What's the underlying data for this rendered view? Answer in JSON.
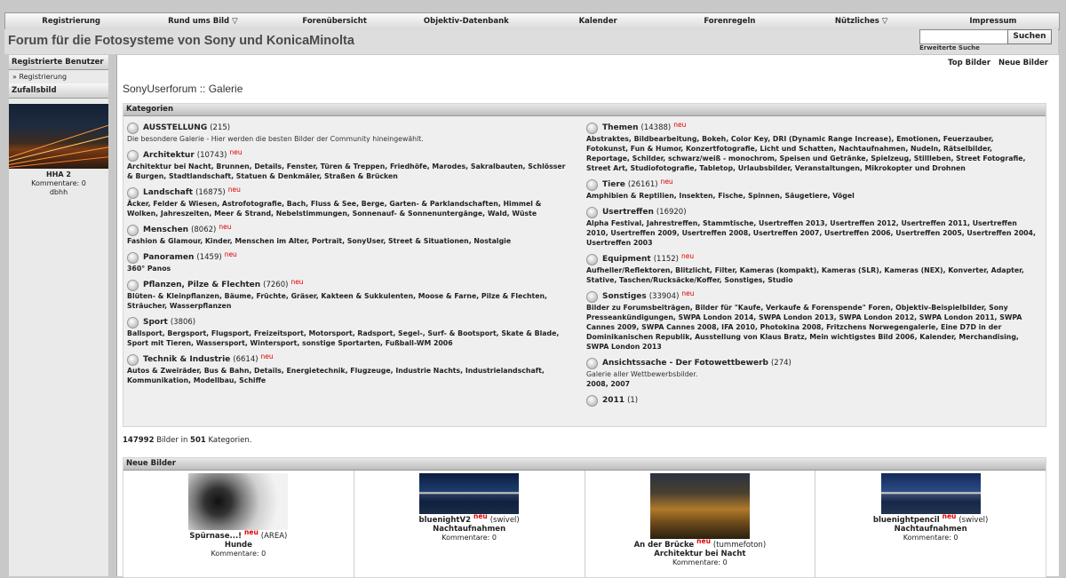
{
  "nav": [
    "Registrierung",
    "Rund ums Bild ▽",
    "Forenübersicht",
    "Objektiv-Datenbank",
    "Kalender",
    "Forenregeln",
    "Nützliches ▽",
    "Impressum"
  ],
  "site_title": "Forum für die Fotosysteme von Sony und KonicaMinolta",
  "search": {
    "button": "Suchen",
    "advanced": "Erweiterte Suche",
    "value": ""
  },
  "sidebar": {
    "registered_head": "Registrierte Benutzer",
    "register_item": "» Registrierung",
    "random_head": "Zufallsbild",
    "random_title": "HHA 2",
    "random_comments": "Kommentare: 0",
    "random_user": "dbhh"
  },
  "top_links": [
    "Top Bilder",
    "Neue Bilder"
  ],
  "gallery_title": "SonyUserforum :: Galerie",
  "categories_head": "Kategorien",
  "new_label": "neu",
  "categories_left": [
    {
      "name": "AUSSTELLUNG",
      "count": "(215)",
      "new": false,
      "desc": "Die besondere Galerie - Hier werden die besten Bilder der Community hineingewählt.",
      "sub": ""
    },
    {
      "name": "Architektur",
      "count": "(10743)",
      "new": true,
      "desc": "",
      "sub": "Architektur bei Nacht, Brunnen, Details, Fenster, Türen & Treppen, Friedhöfe, Marodes, Sakralbauten, Schlösser & Burgen, Stadtlandschaft, Statuen & Denkmäler, Straßen & Brücken"
    },
    {
      "name": "Landschaft",
      "count": "(16875)",
      "new": true,
      "desc": "",
      "sub": "Äcker, Felder & Wiesen, Astrofotografie, Bach, Fluss & See, Berge, Garten- & Parklandschaften, Himmel & Wolken, Jahreszeiten, Meer & Strand, Nebelstimmungen, Sonnenauf- & Sonnenuntergänge, Wald, Wüste"
    },
    {
      "name": "Menschen",
      "count": "(8062)",
      "new": true,
      "desc": "",
      "sub": "Fashion & Glamour, Kinder, Menschen im Alter, Portrait, SonyUser, Street & Situationen, Nostalgie"
    },
    {
      "name": "Panoramen",
      "count": "(1459)",
      "new": true,
      "desc": "",
      "sub": "360° Panos"
    },
    {
      "name": "Pflanzen, Pilze & Flechten",
      "count": "(7260)",
      "new": true,
      "desc": "",
      "sub": "Blüten- & Kleinpflanzen, Bäume, Früchte, Gräser, Kakteen & Sukkulenten, Moose & Farne, Pilze & Flechten, Sträucher, Wasserpflanzen"
    },
    {
      "name": "Sport",
      "count": "(3806)",
      "new": false,
      "desc": "",
      "sub": "Ballsport, Bergsport, Flugsport, Freizeitsport, Motorsport, Radsport, Segel-, Surf- & Bootsport, Skate & Blade, Sport mit Tieren, Wassersport, Wintersport, sonstige Sportarten, Fußball-WM 2006"
    },
    {
      "name": "Technik & Industrie",
      "count": "(6614)",
      "new": true,
      "desc": "",
      "sub": "Autos & Zweiräder, Bus & Bahn, Details, Energietechnik, Flugzeuge, Industrie Nachts, Industrielandschaft, Kommunikation, Modellbau, Schiffe"
    }
  ],
  "categories_right": [
    {
      "name": "Themen",
      "count": "(14388)",
      "new": true,
      "desc": "",
      "sub": "Abstraktes, Bildbearbeitung, Bokeh, Color Key, DRI (Dynamic Range Increase), Emotionen, Feuerzauber, Fotokunst, Fun & Humor, Konzertfotografie, Licht und Schatten, Nachtaufnahmen, Nudeln, Rätselbilder, Reportage, Schilder, schwarz/weiß - monochrom, Speisen und Getränke, Spielzeug, Stillleben, Street Fotografie, Street Art, Studiofotografie, Tabletop, Urlaubsbilder, Veranstaltungen, Mikrokopter und Drohnen"
    },
    {
      "name": "Tiere",
      "count": "(26161)",
      "new": true,
      "desc": "",
      "sub": "Amphibien & Reptilien, Insekten, Fische, Spinnen, Säugetiere, Vögel"
    },
    {
      "name": "Usertreffen",
      "count": "(16920)",
      "new": false,
      "desc": "",
      "sub": "Alpha Festival, Jahrestreffen, Stammtische, Usertreffen 2013, Usertreffen 2012, Usertreffen 2011, Usertreffen 2010, Usertreffen 2009, Usertreffen 2008, Usertreffen 2007, Usertreffen 2006, Usertreffen 2005, Usertreffen 2004, Usertreffen 2003"
    },
    {
      "name": "Equipment",
      "count": "(1152)",
      "new": true,
      "desc": "",
      "sub": "Aufheller/Reflektoren, Blitzlicht, Filter, Kameras (kompakt), Kameras (SLR), Kameras (NEX), Konverter, Adapter, Stative, Taschen/Rucksäcke/Koffer, Sonstiges, Studio"
    },
    {
      "name": "Sonstiges",
      "count": "(33904)",
      "new": true,
      "desc": "",
      "sub": "Bilder zu Forumsbeiträgen, Bilder für \"Kaufe, Verkaufe & Forenspende\" Foren, Objektiv-Beispielbilder, Sony Presseankündigungen, SWPA London 2014, SWPA London 2013, SWPA London 2012, SWPA London 2011, SWPA Cannes 2009, SWPA Cannes 2008, IFA 2010, Photokina 2008, Fritzchens Norwegengalerie, Eine D7D in der Dominikanischen Republik, Ausstellung von Klaus Bratz, Mein wichtigstes Bild 2006, Kalender, Merchandising, SWPA London 2013"
    },
    {
      "name": "Ansichtssache - Der Fotowettbewerb",
      "count": "(274)",
      "new": false,
      "desc": "Galerie aller Wettbewerbsbilder.",
      "sub": "2008, 2007"
    },
    {
      "name": "2011",
      "count": "(1)",
      "new": false,
      "desc": "",
      "sub": ""
    }
  ],
  "stats": {
    "images": "147992",
    "mid": " Bilder in ",
    "cats": "501",
    "tail": " Kategorien."
  },
  "new_images_head": "Neue Bilder",
  "new_images": [
    {
      "title": "Spürnase...!",
      "user": "(AREA)",
      "cat": "Hunde",
      "comments": "Kommentare: 0",
      "img": "dog"
    },
    {
      "title": "bluenightV2",
      "user": "(swivel)",
      "cat": "Nachtaufnahmen",
      "comments": "Kommentare: 0",
      "img": "night"
    },
    {
      "title": "An der Brücke",
      "user": "(tummefoton)",
      "cat": "Architektur bei Nacht",
      "comments": "Kommentare: 0",
      "img": "bridge"
    },
    {
      "title": "bluenightpencil",
      "user": "(swivel)",
      "cat": "Nachtaufnahmen",
      "comments": "Kommentare: 0",
      "img": "night2"
    }
  ]
}
